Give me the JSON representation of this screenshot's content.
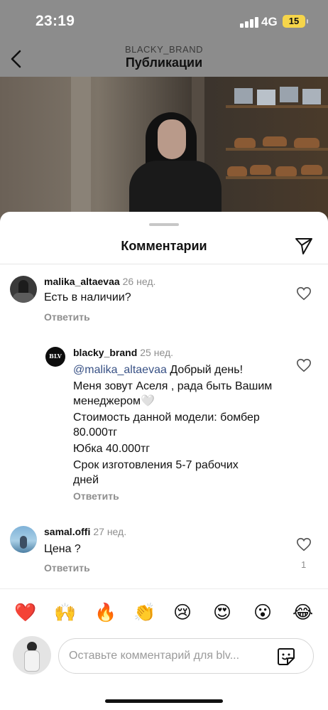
{
  "status_bar": {
    "time": "23:19",
    "network": "4G",
    "battery": "15"
  },
  "header": {
    "account": "BLACKY_BRAND",
    "title": "Публикации"
  },
  "sheet": {
    "title": "Комментарии"
  },
  "comments": [
    {
      "username": "malika_altaevaa",
      "age": "26 нед.",
      "text": "Есть в наличии?",
      "reply_label": "Ответить"
    },
    {
      "username": "blacky_brand",
      "age": "25 нед.",
      "avatar_text": "BLV",
      "mention": "@malika_altaevaa",
      "text_first": " Добрый день!",
      "lines": [
        "Меня зовут Аселя , рада быть Вашим менеджером🤍",
        "Стоимость данной модели: бомбер 80.000тг",
        "Юбка 40.000тг",
        "Срок изготовления 5-7 рабочих дней"
      ],
      "reply_label": "Ответить"
    },
    {
      "username": "samal.offi",
      "age": "27 нед.",
      "text": "Цена ?",
      "reply_label": "Ответить",
      "likes": "1"
    }
  ],
  "emojis": [
    "❤️",
    "🙌",
    "🔥",
    "👏",
    "😢",
    "😍",
    "😮",
    "😂"
  ],
  "input": {
    "placeholder": "Оставьте комментарий для blv..."
  },
  "colors": {
    "mention": "#385185",
    "secondary_text": "#8e8e8e",
    "battery": "#f6d54a"
  }
}
